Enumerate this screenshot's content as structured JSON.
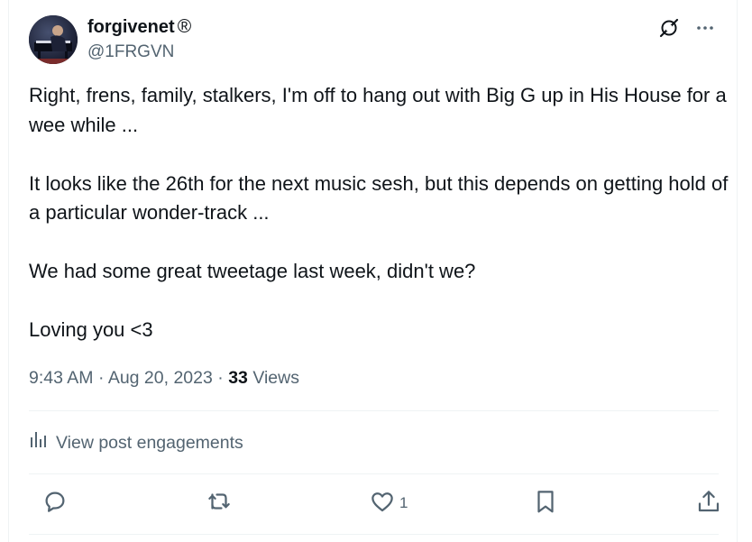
{
  "author": {
    "name": "forgivenet",
    "name_mark": "®",
    "handle": "@1FRGVN"
  },
  "tweet": {
    "paragraphs": [
      "Right, frens, family, stalkers, I'm off to hang out with Big G up in His House for a wee while ...",
      "It looks like the 26th for the next music sesh, but this depends on getting hold of a particular wonder-track ...",
      "We had some great tweetage last week, didn't we?",
      "Loving you <3"
    ],
    "time": "9:43 AM",
    "separator": " · ",
    "date": "Aug 20, 2023",
    "views_count": "33",
    "views_label": "Views"
  },
  "engagements": {
    "label": "View post engagements"
  },
  "actions": {
    "like_count": "1"
  },
  "icons": {
    "top_right": [
      "grok-icon",
      "more-icon"
    ],
    "actions": [
      "reply-icon",
      "retweet-icon",
      "like-icon",
      "bookmark-icon",
      "share-icon"
    ]
  },
  "colors": {
    "text": "#0f1419",
    "secondary": "#536471",
    "divider": "#eff3f4"
  }
}
